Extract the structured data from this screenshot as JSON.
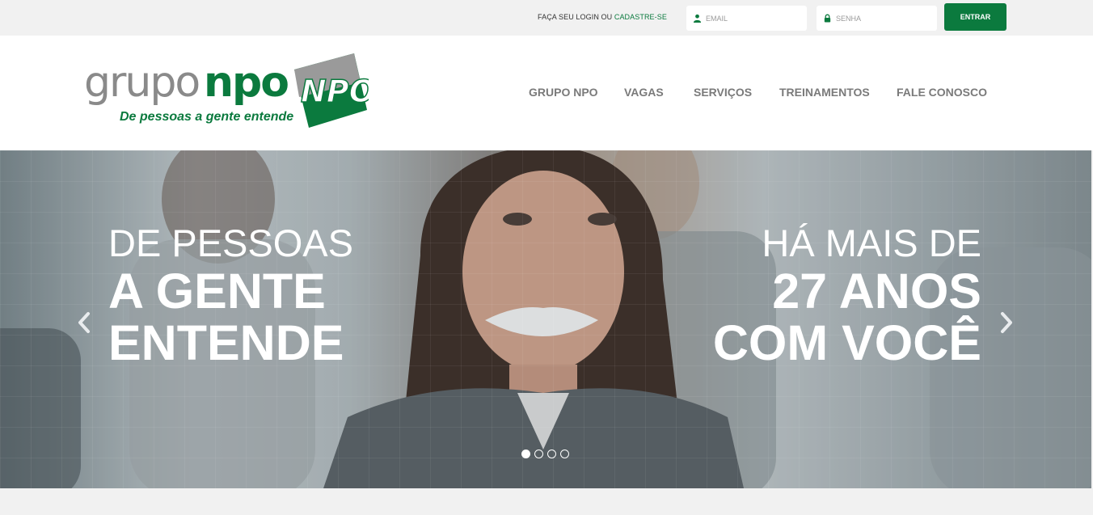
{
  "topbar": {
    "login_prompt": "FAÇA SEU LOGIN OU",
    "register_link": "CADASTRE-SE",
    "email_placeholder": "EMAIL",
    "password_placeholder": "SENHA",
    "submit_label": "ENTRAR",
    "icons": {
      "email": "user-icon",
      "password": "lock-icon"
    }
  },
  "logo": {
    "word1": "grupo",
    "word2": "npo",
    "tagline": "De pessoas a gente entende",
    "mark_text": "NPO"
  },
  "nav": {
    "items": [
      {
        "label": "GRUPO NPO"
      },
      {
        "label": "VAGAS"
      },
      {
        "label": "SERVIÇOS"
      },
      {
        "label": "TREINAMENTOS"
      },
      {
        "label": "FALE CONOSCO"
      }
    ]
  },
  "hero": {
    "left": {
      "line1": "DE PESSOAS",
      "line2": "A GENTE",
      "line3": "ENTENDE"
    },
    "right": {
      "line1": "HÁ MAIS DE",
      "line2": "27 ANOS",
      "line3": "COM VOCÊ"
    },
    "slides_total": 4,
    "active_slide": 1
  },
  "colors": {
    "brand_green": "#0b7a3e",
    "logo_gray": "#8a8a8a",
    "nav_gray": "#7a7a7a"
  }
}
